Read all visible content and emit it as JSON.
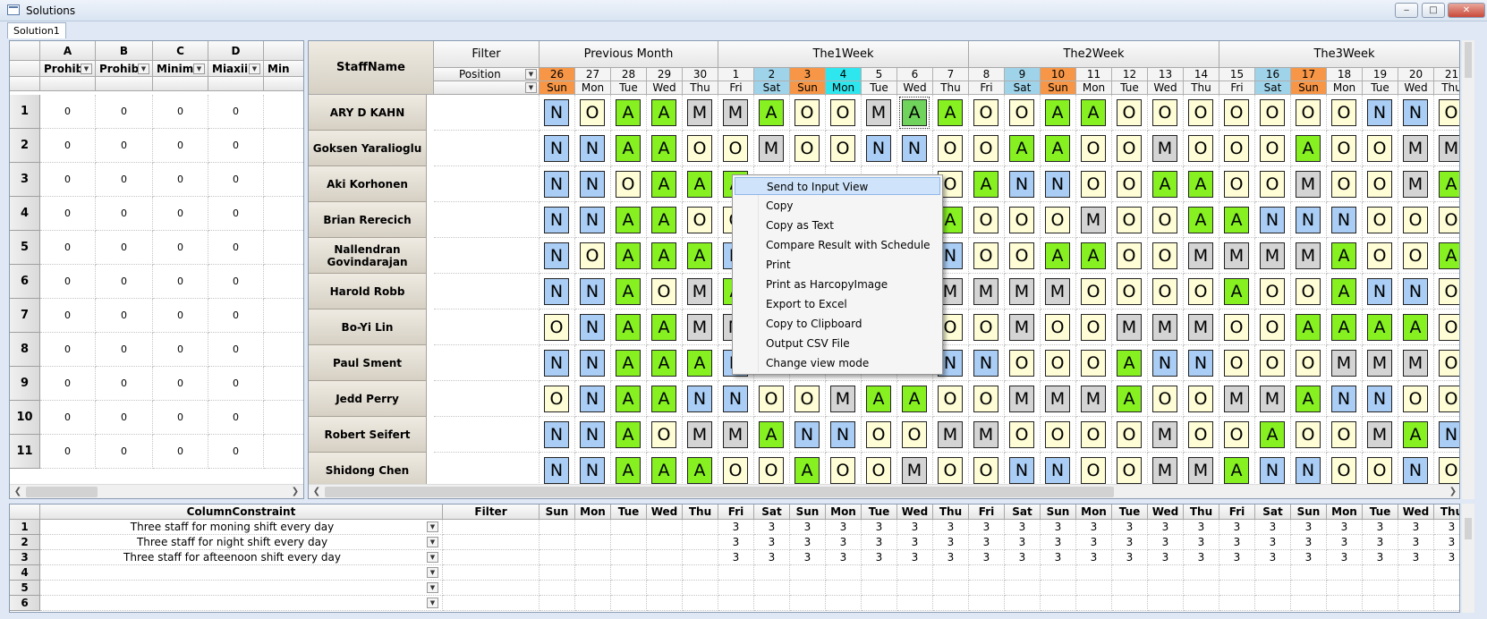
{
  "window": {
    "title": "Solutions",
    "min": "‒",
    "max": "□",
    "close": "✕"
  },
  "tab": {
    "label": "Solution1"
  },
  "leftgrid": {
    "columns": [
      {
        "letter": "A",
        "name": "Prohib"
      },
      {
        "letter": "B",
        "name": "Prohib"
      },
      {
        "letter": "C",
        "name": "Minim"
      },
      {
        "letter": "D",
        "name": "Miaxii"
      },
      {
        "letter": "",
        "name": "Min"
      }
    ],
    "rows": [
      "1",
      "2",
      "3",
      "4",
      "5",
      "6",
      "7",
      "8",
      "9",
      "10",
      "11"
    ],
    "value": "0"
  },
  "schedule": {
    "staff_header": "StaffName",
    "filter_header": "Filter",
    "position_label": "Position",
    "groups": [
      "Previous Month",
      "The1Week",
      "The2Week",
      "The3Week"
    ],
    "days": [
      {
        "d": "26",
        "w": "Sun",
        "c": "#f79646"
      },
      {
        "d": "27",
        "w": "Mon",
        "c": ""
      },
      {
        "d": "28",
        "w": "Tue",
        "c": ""
      },
      {
        "d": "29",
        "w": "Wed",
        "c": ""
      },
      {
        "d": "30",
        "w": "Thu",
        "c": ""
      },
      {
        "d": "1",
        "w": "Fri",
        "c": ""
      },
      {
        "d": "2",
        "w": "Sat",
        "c": "#9fd3e9"
      },
      {
        "d": "3",
        "w": "Sun",
        "c": "#f79646"
      },
      {
        "d": "4",
        "w": "Mon",
        "c": "#2ee6ee"
      },
      {
        "d": "5",
        "w": "Tue",
        "c": ""
      },
      {
        "d": "6",
        "w": "Wed",
        "c": ""
      },
      {
        "d": "7",
        "w": "Thu",
        "c": ""
      },
      {
        "d": "8",
        "w": "Fri",
        "c": ""
      },
      {
        "d": "9",
        "w": "Sat",
        "c": "#9fd3e9"
      },
      {
        "d": "10",
        "w": "Sun",
        "c": "#f79646"
      },
      {
        "d": "11",
        "w": "Mon",
        "c": ""
      },
      {
        "d": "12",
        "w": "Tue",
        "c": ""
      },
      {
        "d": "13",
        "w": "Wed",
        "c": ""
      },
      {
        "d": "14",
        "w": "Thu",
        "c": ""
      },
      {
        "d": "15",
        "w": "Fri",
        "c": ""
      },
      {
        "d": "16",
        "w": "Sat",
        "c": "#9fd3e9"
      },
      {
        "d": "17",
        "w": "Sun",
        "c": "#f79646"
      },
      {
        "d": "18",
        "w": "Mon",
        "c": ""
      },
      {
        "d": "19",
        "w": "Tue",
        "c": ""
      },
      {
        "d": "20",
        "w": "Wed",
        "c": ""
      },
      {
        "d": "21",
        "w": "Thu",
        "c": ""
      }
    ],
    "staff": [
      {
        "name": "ARY D KAHN",
        "shifts": "NOAAMMAOOMAAOOAAOOOOOOONNO"
      },
      {
        "name": "Goksen Yaralioglu",
        "shifts": "NNAAOOMOONNOOAAOOMOOOAOOMM"
      },
      {
        "name": "Aki Korhonen",
        "shifts": "NNOAAA?????OANNOOAAOOMOOMA"
      },
      {
        "name": "Brian Rerecich",
        "shifts": "NNAAOO?????AOOOMOOAANNNOOO"
      },
      {
        "name": "Nallendran Govindarajan",
        "shifts": "NOAAAN?????NOOAAOOMMMMAOOA"
      },
      {
        "name": "Harold Robb",
        "shifts": "NNAOMA?????MMMMOOOOAOOANNO"
      },
      {
        "name": "Bo-Yi Lin",
        "shifts": "ONAAMM?????OOMOOMMMOOAAAAO"
      },
      {
        "name": "Paul Sment",
        "shifts": "NNAAAN?????NNOOOANNOOOMMMO"
      },
      {
        "name": "Jedd Perry",
        "shifts": "ONAANNOOMAAOOMMMAOOMMANNOO"
      },
      {
        "name": "Robert Seifert",
        "shifts": "NNAOMMANNOOMMOOOOMOOAOOMAN"
      },
      {
        "name": "Shidong Chen",
        "shifts": "NNAAAOOAOOMOONNOOMMANNOONO"
      }
    ]
  },
  "menu": {
    "items": [
      "Send to Input View",
      "Copy",
      "Copy as Text",
      "Compare Result with Schedule",
      "Print",
      "Print as HarcopyImage",
      "Export to Excel",
      "Copy to Clipboard",
      "Output CSV File",
      "Change view mode"
    ]
  },
  "bottom": {
    "header": "ColumnConstraint",
    "filter": "Filter",
    "rows": [
      {
        "n": "1",
        "text": "Three staff for moning shift every day",
        "val": "3"
      },
      {
        "n": "2",
        "text": "Three staff for night shift every day",
        "val": "3"
      },
      {
        "n": "3",
        "text": "Three staff for afteenoon shift every day",
        "val": "3"
      },
      {
        "n": "4",
        "text": "",
        "val": ""
      },
      {
        "n": "5",
        "text": "",
        "val": ""
      },
      {
        "n": "6",
        "text": "",
        "val": ""
      }
    ]
  },
  "colors": {
    "N": "#a9cdf5",
    "A": "#86f021",
    "O": "#fefdd5",
    "M": "#d4d4d4"
  }
}
